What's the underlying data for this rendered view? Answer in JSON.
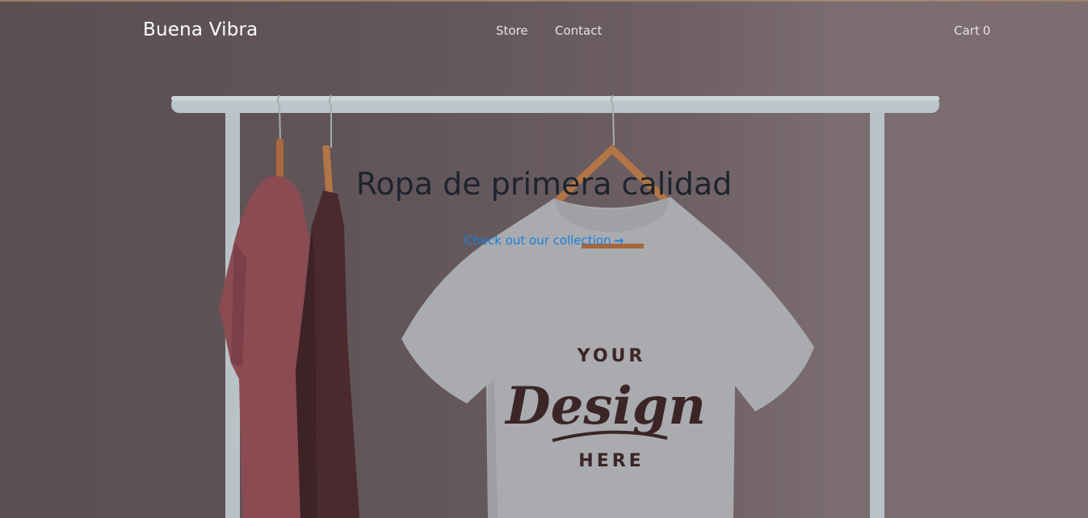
{
  "brand": {
    "name": "Buena Vibra"
  },
  "nav": {
    "items": [
      {
        "label": "Store"
      },
      {
        "label": "Contact"
      }
    ]
  },
  "cart": {
    "label": "Cart",
    "count": "0"
  },
  "hero": {
    "headline": "Ropa de primera calidad",
    "cta_label": "Check out our collection",
    "cta_icon": "arrow-right-icon",
    "tshirt_print": {
      "line1": "YOUR",
      "line2": "Design",
      "line3": "HERE"
    }
  },
  "colors": {
    "link": "#1b7fe0",
    "headline": "#1d242c",
    "nav_text": "#e7e2e3",
    "brand_text": "#ffffff"
  }
}
